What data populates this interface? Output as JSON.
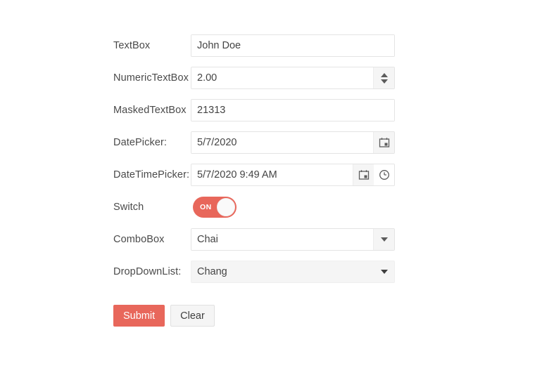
{
  "colors": {
    "accent": "#e8675b",
    "field_border": "#e4e4e4",
    "field_button_bg": "#f5f5f5",
    "text": "#444444"
  },
  "form": {
    "rows": [
      {
        "label": "TextBox",
        "type": "textbox",
        "value": "John Doe",
        "name": "textbox"
      },
      {
        "label": "NumericTextBox",
        "type": "numerictextbox",
        "value": "2.00",
        "name": "numerictextbox"
      },
      {
        "label": "MaskedTextBox",
        "type": "maskedtextbox",
        "value": "21313",
        "name": "maskedtextbox"
      },
      {
        "label": "DatePicker:",
        "type": "datepicker",
        "value": "5/7/2020",
        "name": "datepicker"
      },
      {
        "label": "DateTimePicker:",
        "type": "datetimepicker",
        "value": "5/7/2020 9:49 AM",
        "name": "datetimepicker"
      },
      {
        "label": "Switch",
        "type": "switch",
        "value": "ON",
        "name": "switch"
      },
      {
        "label": "ComboBox",
        "type": "combobox",
        "value": "Chai",
        "name": "combobox"
      },
      {
        "label": "DropDownList:",
        "type": "dropdownlist",
        "value": "Chang",
        "name": "dropdownlist"
      }
    ]
  },
  "buttons": {
    "submit_label": "Submit",
    "clear_label": "Clear"
  },
  "icons": {
    "spinner_up": "triangle-up-icon",
    "spinner_down": "triangle-down-icon",
    "calendar": "calendar-icon",
    "clock": "clock-icon",
    "combo_arrow": "chevron-down-icon"
  }
}
